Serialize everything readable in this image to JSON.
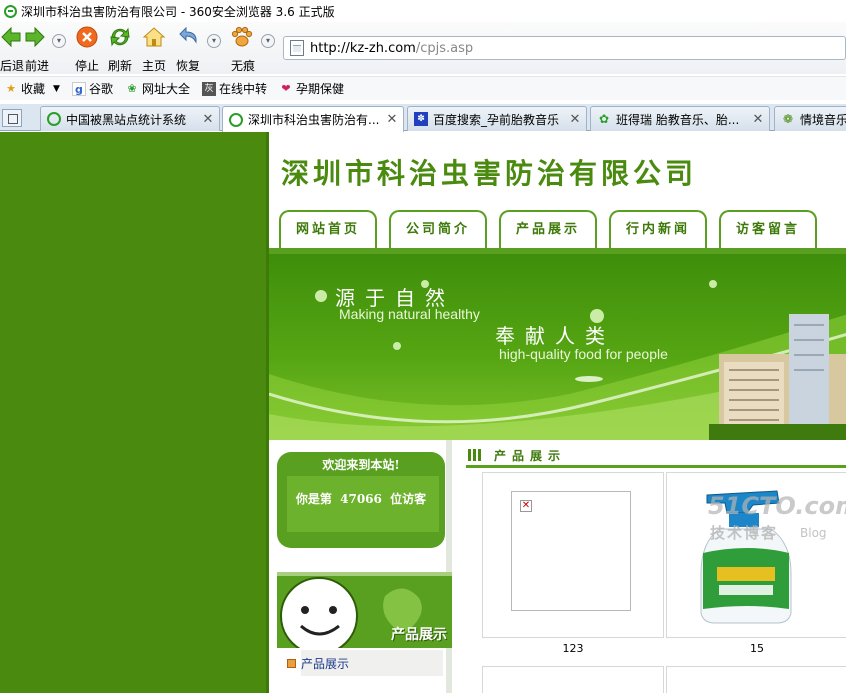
{
  "window": {
    "title": "深圳市科治虫害防治有限公司 - 360安全浏览器 3.6 正式版"
  },
  "toolbar": {
    "back_label": "后退",
    "forward_label": "前进",
    "stop_label": "停止",
    "refresh_label": "刷新",
    "home_label": "主页",
    "restore_label": "恢复",
    "traceless_label": "无痕"
  },
  "address": {
    "host": "http://kz-zh.com",
    "path": "/cpjs.asp"
  },
  "favorites": {
    "items": [
      {
        "label": "收藏",
        "icon": "star-icon"
      },
      {
        "label": "谷歌",
        "icon": "google-icon"
      },
      {
        "label": "网址大全",
        "icon": "globe-icon"
      },
      {
        "label": "在线中转",
        "icon": "transfer-icon"
      },
      {
        "label": "孕期保健",
        "icon": "heart-icon"
      }
    ]
  },
  "tabs": [
    {
      "label": "中国被黑站点统计系统"
    },
    {
      "label": "深圳市科治虫害防治有..."
    },
    {
      "label": "百度搜索_孕前胎教音乐"
    },
    {
      "label": "班得瑞 胎教音乐、胎..."
    },
    {
      "label": "情境音乐"
    }
  ],
  "site": {
    "title": "深圳市科治虫害防治有限公司",
    "nav": [
      "网站首页",
      "公司简介",
      "产品展示",
      "行内新闻",
      "访客留言"
    ],
    "banner": {
      "line1": "源于自然",
      "line2": "Making natural healthy",
      "line3": "奉献人类",
      "line4": "high-quality food for people"
    },
    "welcome": {
      "title": "欢迎来到本站!",
      "prefix": "你是第",
      "count": "47066",
      "suffix": "位访客"
    },
    "side_banner_title": "产品展示",
    "side_link": "产品展示",
    "section_title": "产品展示",
    "products": [
      {
        "caption": "123"
      },
      {
        "caption": "15"
      }
    ]
  },
  "watermark": {
    "line1": "51CTO.com",
    "line2": "技术博客",
    "line3": "Blog"
  },
  "colors": {
    "site_green": "#4a8a0f",
    "accent_green": "#5aa020"
  }
}
